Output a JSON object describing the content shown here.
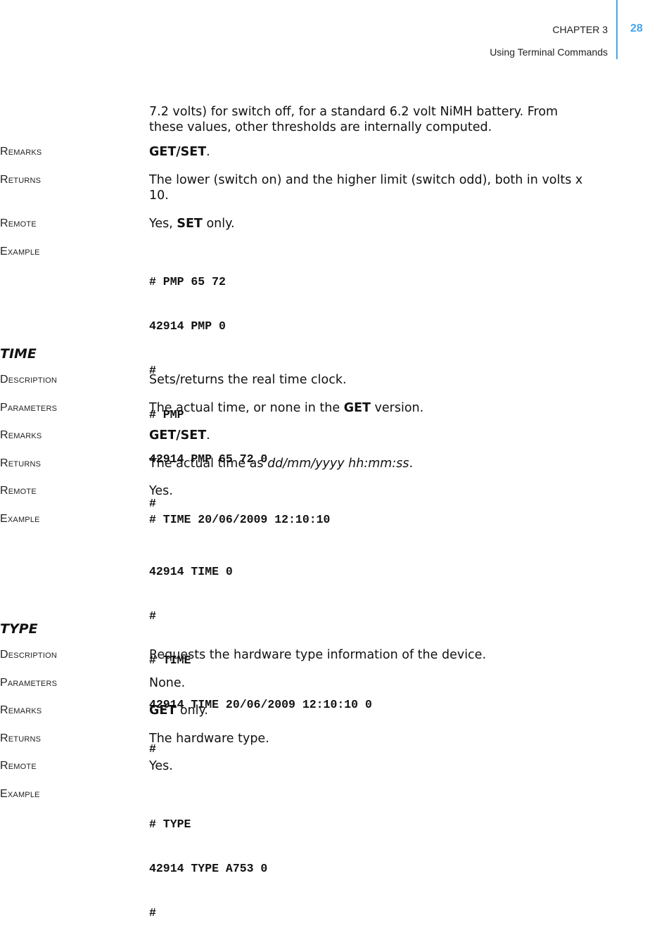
{
  "header": {
    "chapter": "CHAPTER 3",
    "subtitle": "Using Terminal Commands",
    "page_number": "28",
    "accent_color": "#4aa3e8"
  },
  "intro": {
    "line1": "7.2 volts) for switch off, for a standard 6.2 volt NiMH battery. From",
    "line2": "these values, other thresholds are internally computed."
  },
  "pmp": {
    "remarks_label": "Remarks",
    "remarks_bold": "GET/SET",
    "remarks_tail": ".",
    "returns_label": "Returns",
    "returns_line1": "The lower (switch on) and the higher limit (switch odd), both in volts x",
    "returns_line2": "10.",
    "remote_label": "Remote",
    "remote_pre": "Yes, ",
    "remote_bold": "SET",
    "remote_tail": " only.",
    "example_label": "Example",
    "example_lines": [
      "# PMP 65 72",
      "42914 PMP 0",
      "#",
      "# PMP",
      "42914 PMP 65 72 0",
      "#"
    ]
  },
  "time": {
    "title": "TIME",
    "description_label": "Description",
    "description": "Sets/returns the real time clock.",
    "parameters_label": "Parameters",
    "parameters_pre": "The actual time, or none in the ",
    "parameters_bold": "GET",
    "parameters_tail": " version.",
    "remarks_label": "Remarks",
    "remarks_bold": "GET/SET",
    "remarks_tail": ".",
    "returns_label": "Returns",
    "returns_pre": "The actual time as ",
    "returns_italic": "dd/mm/yyyy hh:mm:ss",
    "returns_tail": ".",
    "remote_label": "Remote",
    "remote": "Yes.",
    "example_label": "Example",
    "example_first": "# TIME 20/06/2009 12:10:10",
    "example_lines": [
      "42914 TIME 0",
      "#",
      "# TIME",
      "42914 TIME 20/06/2009 12:10:10 0",
      "#"
    ]
  },
  "type": {
    "title": "TYPE",
    "description_label": "Description",
    "description": "Requests the hardware type information of the device.",
    "parameters_label": "Parameters",
    "parameters": "None.",
    "remarks_label": "Remarks",
    "remarks_bold": "GET",
    "remarks_tail": " only.",
    "returns_label": "Returns",
    "returns": "The hardware type.",
    "remote_label": "Remote",
    "remote": "Yes.",
    "example_label": "Example",
    "example_lines": [
      "# TYPE",
      "42914 TYPE A753 0",
      "#"
    ]
  }
}
